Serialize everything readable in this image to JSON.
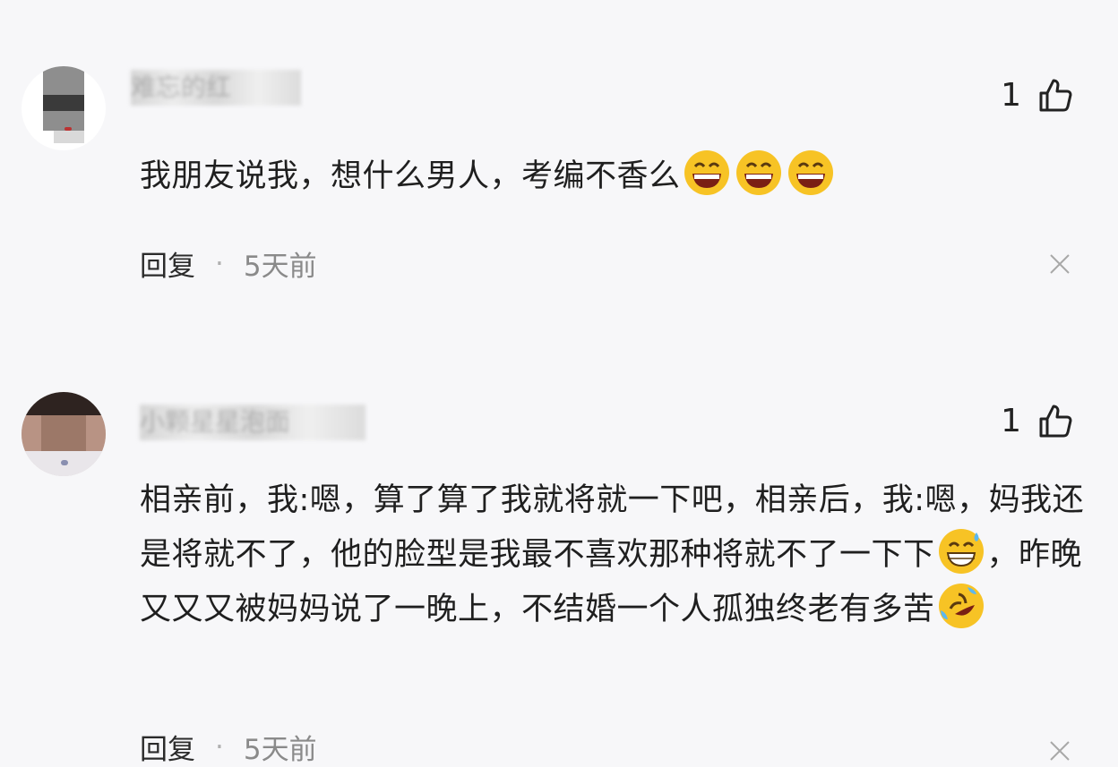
{
  "comments": [
    {
      "username": "难忘的红",
      "likes": "1",
      "text_parts": [
        "我朋友说我，想什么男人，考编不香么"
      ],
      "reply_label": "回复",
      "separator": "·",
      "time": "5天前"
    },
    {
      "username": "小颗星星泡面",
      "likes": "1",
      "text_parts": [
        "相亲前，我:嗯，算了算了我就将就一下吧，相亲后，我:嗯，妈我还是将就不了，他的脸型是我最不喜欢那种将就不了一下下",
        "，昨晚又又又被妈妈说了一晚上，不结婚一个人孤独终老有多苦"
      ],
      "reply_label": "回复",
      "separator": "·",
      "time": "5天前"
    }
  ],
  "icons": {
    "like": "thumbs-up-icon",
    "close": "close-icon",
    "emoji_laugh": "grinning-laugh-emoji",
    "emoji_sweat": "grinning-sweat-emoji",
    "emoji_rofl": "rolling-laughing-emoji"
  },
  "colors": {
    "background": "#f7f7f9",
    "text": "#1f1f1f",
    "time": "#8a8a8a",
    "emoji_yellow": "#f7c325"
  }
}
